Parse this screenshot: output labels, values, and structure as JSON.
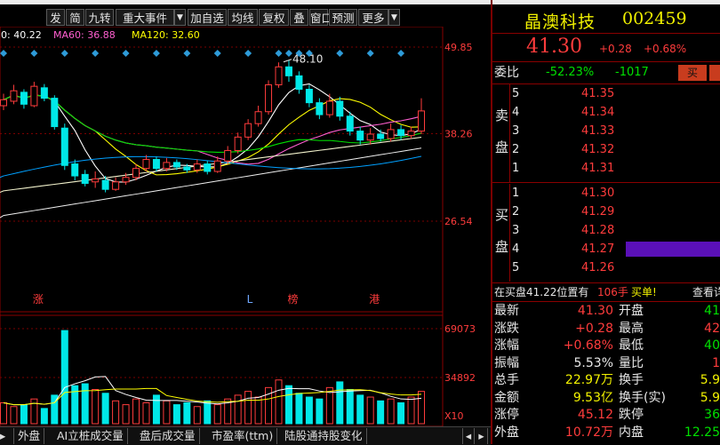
{
  "toolbar": {
    "buttons": [
      "发",
      "简",
      "九转",
      "重大事件",
      "加自选",
      "均线",
      "复权",
      "叠",
      "窗口",
      "预测",
      "更多"
    ]
  },
  "ma_legend": [
    {
      "label": "0: 40.22",
      "color": "#ffffff"
    },
    {
      "label": "MA60: 36.88",
      "color": "#ff5fd0"
    },
    {
      "label": "MA120: 32.60",
      "color": "#ffff00"
    }
  ],
  "chart_data": [
    {
      "type": "candlestick",
      "price_axis": {
        "ticks": [
          "49.85",
          "38.26",
          "26.54"
        ]
      },
      "annotations": [
        {
          "text": "48.10",
          "x": 28,
          "y": 48.1,
          "color": "#e8e8e8"
        }
      ],
      "event_markers": [
        {
          "text": "涨",
          "x": 2,
          "color": "#ff3c3c"
        },
        {
          "text": "L",
          "x": 23,
          "color": "#6fa8ff"
        },
        {
          "text": "榜",
          "x": 27,
          "color": "#ff3c3c"
        },
        {
          "text": "港",
          "x": 35,
          "color": "#ff3c3c"
        }
      ],
      "candles": [
        {
          "x": 0,
          "o": 42.0,
          "c": 42.8,
          "h": 43.6,
          "l": 41.4
        },
        {
          "x": 1,
          "o": 42.6,
          "c": 44.0,
          "h": 44.8,
          "l": 42.2
        },
        {
          "x": 2,
          "o": 43.8,
          "c": 42.2,
          "h": 44.2,
          "l": 41.6
        },
        {
          "x": 3,
          "o": 42.0,
          "c": 44.6,
          "h": 45.2,
          "l": 41.8
        },
        {
          "x": 4,
          "o": 44.4,
          "c": 43.0,
          "h": 44.9,
          "l": 42.6
        },
        {
          "x": 5,
          "o": 43.0,
          "c": 39.2,
          "h": 43.4,
          "l": 38.8
        },
        {
          "x": 6,
          "o": 39.0,
          "c": 34.0,
          "h": 39.6,
          "l": 33.4
        },
        {
          "x": 7,
          "o": 34.2,
          "c": 32.6,
          "h": 34.8,
          "l": 32.0
        },
        {
          "x": 8,
          "o": 32.8,
          "c": 31.6,
          "h": 33.4,
          "l": 31.2
        },
        {
          "x": 9,
          "o": 31.8,
          "c": 32.2,
          "h": 33.2,
          "l": 31.0
        },
        {
          "x": 10,
          "o": 32.0,
          "c": 30.8,
          "h": 32.6,
          "l": 30.4
        },
        {
          "x": 11,
          "o": 30.8,
          "c": 31.8,
          "h": 32.4,
          "l": 30.6
        },
        {
          "x": 12,
          "o": 31.8,
          "c": 32.4,
          "h": 33.0,
          "l": 31.4
        },
        {
          "x": 13,
          "o": 32.4,
          "c": 33.6,
          "h": 34.2,
          "l": 32.0
        },
        {
          "x": 14,
          "o": 33.6,
          "c": 34.8,
          "h": 35.4,
          "l": 33.2
        },
        {
          "x": 15,
          "o": 34.8,
          "c": 33.6,
          "h": 35.2,
          "l": 33.2
        },
        {
          "x": 16,
          "o": 33.6,
          "c": 34.4,
          "h": 35.0,
          "l": 33.2
        },
        {
          "x": 17,
          "o": 34.4,
          "c": 33.8,
          "h": 34.8,
          "l": 33.4
        },
        {
          "x": 18,
          "o": 33.8,
          "c": 33.4,
          "h": 34.2,
          "l": 33.0
        },
        {
          "x": 19,
          "o": 33.4,
          "c": 34.2,
          "h": 34.8,
          "l": 33.0
        },
        {
          "x": 20,
          "o": 34.2,
          "c": 33.2,
          "h": 34.6,
          "l": 32.8
        },
        {
          "x": 21,
          "o": 33.2,
          "c": 34.6,
          "h": 35.2,
          "l": 33.0
        },
        {
          "x": 22,
          "o": 34.6,
          "c": 36.0,
          "h": 36.6,
          "l": 34.2
        },
        {
          "x": 23,
          "o": 36.0,
          "c": 37.8,
          "h": 38.4,
          "l": 35.6
        },
        {
          "x": 24,
          "o": 37.8,
          "c": 39.6,
          "h": 40.2,
          "l": 37.4
        },
        {
          "x": 25,
          "o": 39.6,
          "c": 41.2,
          "h": 42.0,
          "l": 39.2
        },
        {
          "x": 26,
          "o": 41.2,
          "c": 44.8,
          "h": 45.4,
          "l": 40.8
        },
        {
          "x": 27,
          "o": 44.8,
          "c": 47.2,
          "h": 47.8,
          "l": 44.4
        },
        {
          "x": 28,
          "o": 47.2,
          "c": 46.0,
          "h": 48.1,
          "l": 45.2
        },
        {
          "x": 29,
          "o": 46.0,
          "c": 44.2,
          "h": 46.6,
          "l": 43.6
        },
        {
          "x": 30,
          "o": 44.2,
          "c": 42.4,
          "h": 44.8,
          "l": 41.8
        },
        {
          "x": 31,
          "o": 42.4,
          "c": 40.8,
          "h": 43.0,
          "l": 40.2
        },
        {
          "x": 32,
          "o": 40.8,
          "c": 42.6,
          "h": 43.6,
          "l": 40.4
        },
        {
          "x": 33,
          "o": 42.6,
          "c": 40.6,
          "h": 43.2,
          "l": 40.0
        },
        {
          "x": 34,
          "o": 40.6,
          "c": 38.6,
          "h": 41.2,
          "l": 38.0
        },
        {
          "x": 35,
          "o": 38.6,
          "c": 37.4,
          "h": 39.2,
          "l": 36.8
        },
        {
          "x": 36,
          "o": 37.4,
          "c": 38.2,
          "h": 39.0,
          "l": 36.8
        },
        {
          "x": 37,
          "o": 38.2,
          "c": 37.6,
          "h": 38.8,
          "l": 37.2
        },
        {
          "x": 38,
          "o": 37.6,
          "c": 38.8,
          "h": 39.6,
          "l": 37.2
        },
        {
          "x": 39,
          "o": 38.8,
          "c": 38.0,
          "h": 39.4,
          "l": 37.4
        },
        {
          "x": 40,
          "o": 38.0,
          "c": 38.6,
          "h": 39.2,
          "l": 37.6
        },
        {
          "x": 41,
          "o": 38.6,
          "c": 41.3,
          "h": 43.0,
          "l": 38.2
        }
      ],
      "volume_axis": {
        "ticks": [
          "69073",
          "34892",
          "X10"
        ]
      },
      "volume": [
        22,
        18,
        20,
        26,
        16,
        30,
        98,
        40,
        42,
        36,
        32,
        24,
        20,
        26,
        22,
        30,
        24,
        20,
        22,
        18,
        24,
        20,
        26,
        30,
        34,
        28,
        38,
        46,
        40,
        32,
        28,
        26,
        38,
        44,
        36,
        30,
        28,
        24,
        26,
        22,
        28,
        34
      ]
    }
  ],
  "bottom_tabs": [
    "外盘",
    "AI立桩成交量",
    "盘后成交量",
    "市盈率(ttm)",
    "陆股通持股变化"
  ],
  "stock": {
    "name": "晶澳科技",
    "code": "002459",
    "price": "41.30",
    "change": "+0.28",
    "change_pct": "+0.68%"
  },
  "order_ratio": {
    "label": "委比",
    "pct": "-52.23%",
    "diff": "-1017",
    "sell_btn": "买"
  },
  "order_book": {
    "sell_label": [
      "卖",
      "盘"
    ],
    "buy_label": [
      "买",
      "盘"
    ],
    "sells": [
      {
        "level": "5",
        "price": "41.35"
      },
      {
        "level": "4",
        "price": "41.34"
      },
      {
        "level": "3",
        "price": "41.33"
      },
      {
        "level": "2",
        "price": "41.32"
      },
      {
        "level": "1",
        "price": "41.31"
      }
    ],
    "buys": [
      {
        "level": "1",
        "price": "41.30"
      },
      {
        "level": "2",
        "price": "41.29"
      },
      {
        "level": "3",
        "price": "41.28"
      },
      {
        "level": "4",
        "price": "41.27"
      },
      {
        "level": "5",
        "price": "41.26"
      }
    ]
  },
  "notice": {
    "text1": "在买盘",
    "text2": "41.22位置有",
    "qty": "106手",
    "action": "买单!",
    "more": "查看详"
  },
  "stats": [
    {
      "l1": "最新",
      "v1": "41.30",
      "c1": "red",
      "l2": "开盘",
      "v2": "41",
      "c2": "green"
    },
    {
      "l1": "涨跌",
      "v1": "+0.28",
      "c1": "red",
      "l2": "最高",
      "v2": "42",
      "c2": "red"
    },
    {
      "l1": "涨幅",
      "v1": "+0.68%",
      "c1": "red",
      "l2": "最低",
      "v2": "40",
      "c2": "green"
    },
    {
      "l1": "振幅",
      "v1": "5.53%",
      "c1": "white",
      "l2": "量比",
      "v2": "1",
      "c2": "red"
    },
    {
      "l1": "总手",
      "v1": "22.97万",
      "c1": "yellow",
      "l2": "换手",
      "v2": "5.9",
      "c2": "yellow"
    },
    {
      "l1": "金额",
      "v1": "9.53亿",
      "c1": "yellow",
      "l2": "换手(实)",
      "v2": "5.9",
      "c2": "yellow"
    },
    {
      "l1": "涨停",
      "v1": "45.12",
      "c1": "red",
      "l2": "跌停",
      "v2": "36",
      "c2": "green"
    },
    {
      "l1": "外盘",
      "v1": "10.72万",
      "c1": "red",
      "l2": "内盘",
      "v2": "12.25",
      "c2": "green"
    }
  ],
  "colors": {
    "up": "#ff3c3c",
    "down": "#00e8e8",
    "accent": "#f2f200",
    "bg": "#000000"
  }
}
